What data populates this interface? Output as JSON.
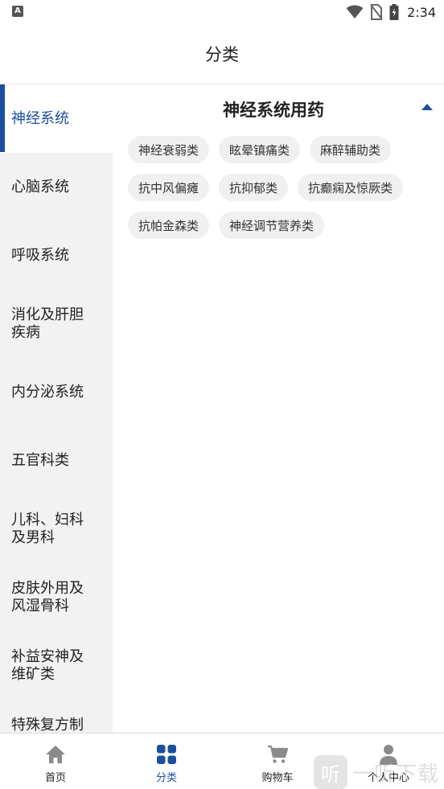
{
  "status_bar": {
    "notification_badge": "A",
    "time": "2:34",
    "icons": [
      "wifi-icon",
      "no-sim-icon",
      "battery-charging-icon"
    ]
  },
  "header": {
    "title": "分类"
  },
  "sidebar": {
    "items": [
      {
        "label": "神经系统",
        "active": true
      },
      {
        "label": "心脑系统",
        "active": false
      },
      {
        "label": "呼吸系统",
        "active": false
      },
      {
        "label": "消化及肝胆疾病",
        "active": false
      },
      {
        "label": "内分泌系统",
        "active": false
      },
      {
        "label": "五官科类",
        "active": false
      },
      {
        "label": "儿科、妇科及男科",
        "active": false
      },
      {
        "label": "皮肤外用及风湿骨科",
        "active": false
      },
      {
        "label": "补益安神及维矿类",
        "active": false
      },
      {
        "label": "特殊复方制剂及生物制",
        "active": false
      }
    ]
  },
  "main": {
    "section_title": "神经系统用药",
    "collapse_icon": "caret-up-icon",
    "tags": [
      "神经衰弱类",
      "眩晕镇痛类",
      "麻醉辅助类",
      "抗中风偏瘫",
      "抗抑郁类",
      "抗癫痫及惊厥类",
      "抗帕金森类",
      "神经调节营养类"
    ]
  },
  "bottom_nav": {
    "items": [
      {
        "label": "首页",
        "icon": "home-icon",
        "active": false
      },
      {
        "label": "分类",
        "icon": "category-grid-icon",
        "active": true
      },
      {
        "label": "购物车",
        "icon": "cart-icon",
        "active": false
      },
      {
        "label": "个人中心",
        "icon": "user-icon",
        "active": false
      }
    ]
  },
  "watermark": {
    "logo_char": "听",
    "text": "一听下载"
  },
  "colors": {
    "accent": "#1b4f9f",
    "sidebar_bg": "#f2f2f2",
    "tag_bg": "#f0f0f0",
    "icon_gray": "#8a8a8a"
  }
}
